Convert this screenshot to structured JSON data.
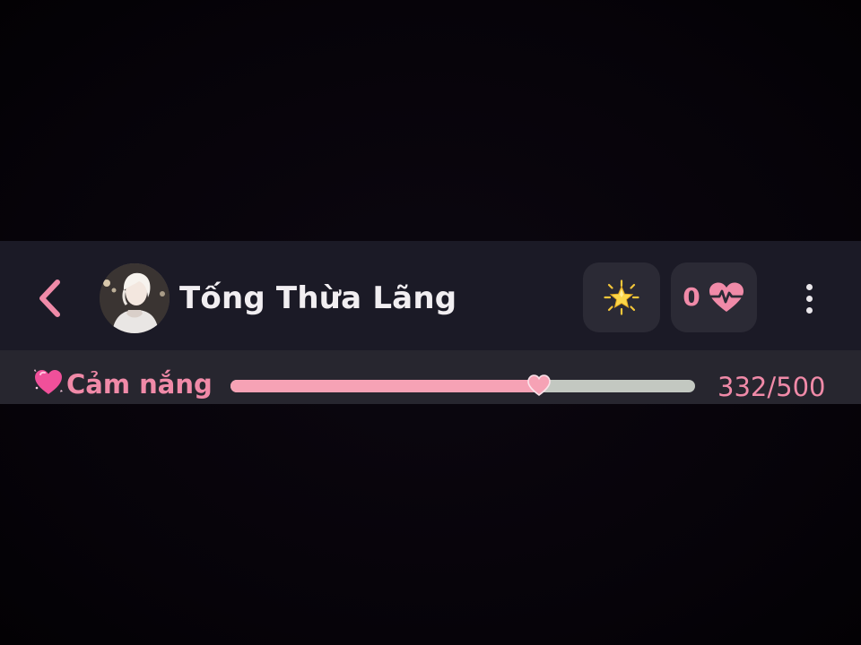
{
  "header": {
    "back_icon": "chevron-left-icon",
    "character_name": "Tống Thừa Lãng",
    "star_icon": "glowing-star-icon",
    "hearts_count": "0",
    "hearts_icon": "heart-pulse-icon",
    "more_icon": "vertical-ellipsis-icon"
  },
  "affection": {
    "icon": "sparkling-heart-icon",
    "label": "Cảm nắng",
    "current": 332,
    "max": 500,
    "value_text": "332/500",
    "fraction": 0.664
  },
  "colors": {
    "accent_pink": "#f08aa8",
    "progress_fill": "#f6a2b5",
    "progress_track": "#c3c8c1",
    "header_bg": "#1b1a26",
    "bar_bg": "#27262f",
    "button_bg": "#2b2a35"
  }
}
